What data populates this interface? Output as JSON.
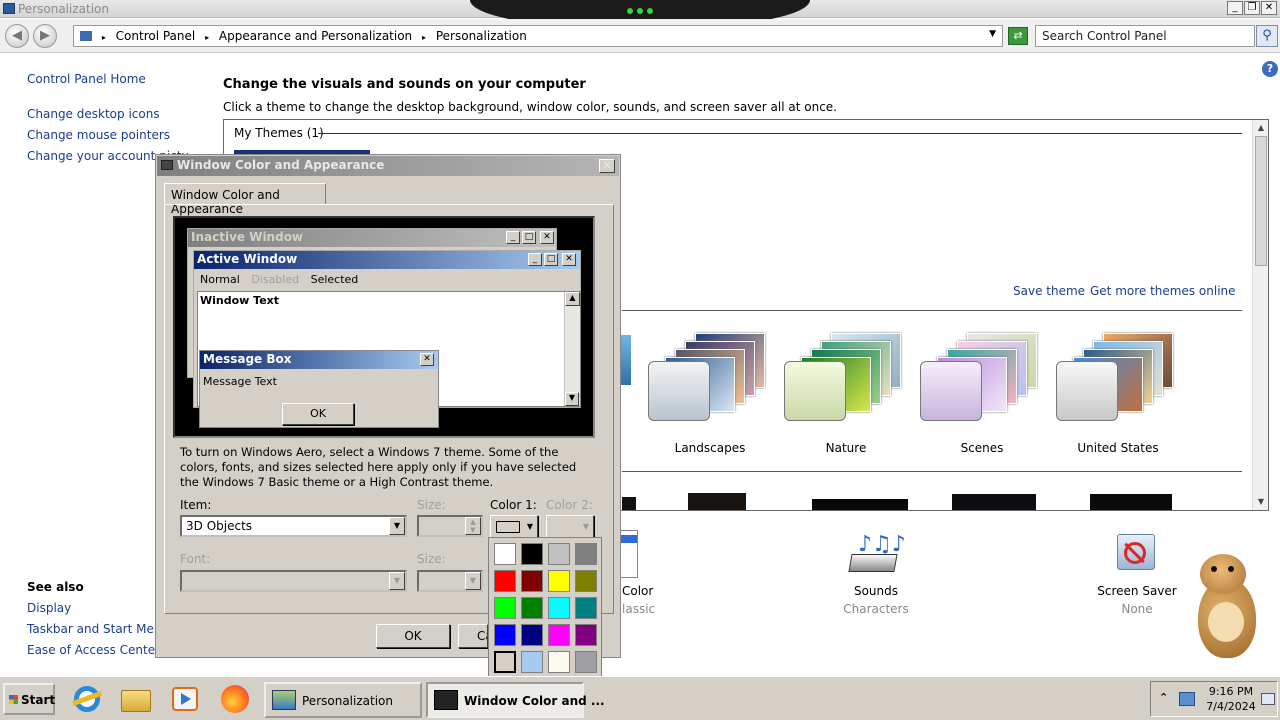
{
  "window": {
    "title": "Personalization"
  },
  "address": {
    "crumbs": [
      "Control Panel",
      "Appearance and Personalization",
      "Personalization"
    ],
    "search_placeholder": "Search Control Panel"
  },
  "sidebar": {
    "home": "Control Panel Home",
    "links": [
      "Change desktop icons",
      "Change mouse pointers",
      "Change your account pictu"
    ],
    "see_also_title": "See also",
    "see_also": [
      "Display",
      "Taskbar and Start Menu",
      "Ease of Access Center"
    ]
  },
  "main": {
    "heading": "Change the visuals and sounds on your computer",
    "subheading": "Click a theme to change the desktop background, window color, sounds, and screen saver all at once.",
    "my_themes": "My Themes (1)",
    "save_theme": "Save theme",
    "more_themes": "Get more themes online",
    "themes": [
      "Landscapes",
      "Nature",
      "Scenes",
      "United States"
    ],
    "bottom": {
      "color_label": "Color",
      "color_sub": "lassic",
      "sounds_label": "Sounds",
      "sounds_sub": "Characters",
      "saver_label": "Screen Saver",
      "saver_sub": "None"
    }
  },
  "dialog": {
    "title": "Window Color and Appearance",
    "tab": "Window Color and Appearance",
    "preview": {
      "inactive": "Inactive Window",
      "active": "Active Window",
      "menu_normal": "Normal",
      "menu_disabled": "Disabled",
      "menu_selected": "Selected",
      "window_text": "Window Text",
      "msg_title": "Message Box",
      "msg_text": "Message Text",
      "msg_ok": "OK"
    },
    "description": "To turn on Windows Aero, select a Windows 7 theme.  Some of the colors, fonts, and sizes selected here apply only if you have selected the Windows 7 Basic theme or a High Contrast theme.",
    "item_label": "Item:",
    "item_value": "3D Objects",
    "size_label": "Size:",
    "color1_label": "Color 1:",
    "color2_label": "Color 2:",
    "font_label": "Font:",
    "size2_label": "Size:",
    "ok": "OK",
    "cancel": "Ca"
  },
  "palette": {
    "colors": [
      "#ffffff",
      "#000000",
      "#c0c0c0",
      "#808080",
      "#ff0000",
      "#800000",
      "#ffff00",
      "#808000",
      "#00ff00",
      "#008000",
      "#00ffff",
      "#008080",
      "#0000ff",
      "#000080",
      "#ff00ff",
      "#800080",
      "#d4d0c8",
      "#a6caf0",
      "#fffbf0",
      "#a0a0a4"
    ],
    "selected_index": 16
  },
  "taskbar": {
    "start": "Start",
    "tasks": [
      "Personalization",
      "Window Color and ..."
    ],
    "time": "9:16 PM",
    "date": "7/4/2024"
  }
}
